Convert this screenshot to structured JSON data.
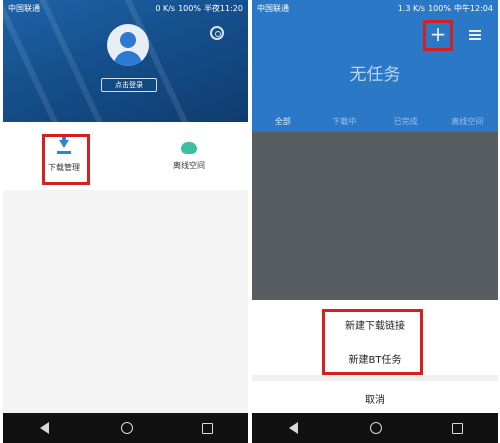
{
  "left": {
    "status": {
      "carrier": "中国联通",
      "speed": "0 K/s",
      "battery": "100%",
      "time": "半夜11:20"
    },
    "login_label": "点击登录",
    "menu": [
      {
        "label": "下载管理",
        "icon": "download-icon"
      },
      {
        "label": "离线空间",
        "icon": "cloud-icon"
      }
    ]
  },
  "right": {
    "status": {
      "carrier": "中国联通",
      "speed": "1.3 K/s",
      "battery": "100%",
      "time": "中午12:04"
    },
    "plus_label": "+",
    "empty_title": "无任务",
    "tabs": [
      "全部",
      "下载中",
      "已完成",
      "离线空间"
    ],
    "sheet": {
      "new_link": "新建下载链接",
      "new_bt": "新建BT任务",
      "cancel": "取消"
    }
  },
  "colors": {
    "header_blue": "#2a78c6",
    "highlight_red": "#d32020",
    "accent_blue": "#2b86d6",
    "accent_green": "#3cc0a0"
  }
}
